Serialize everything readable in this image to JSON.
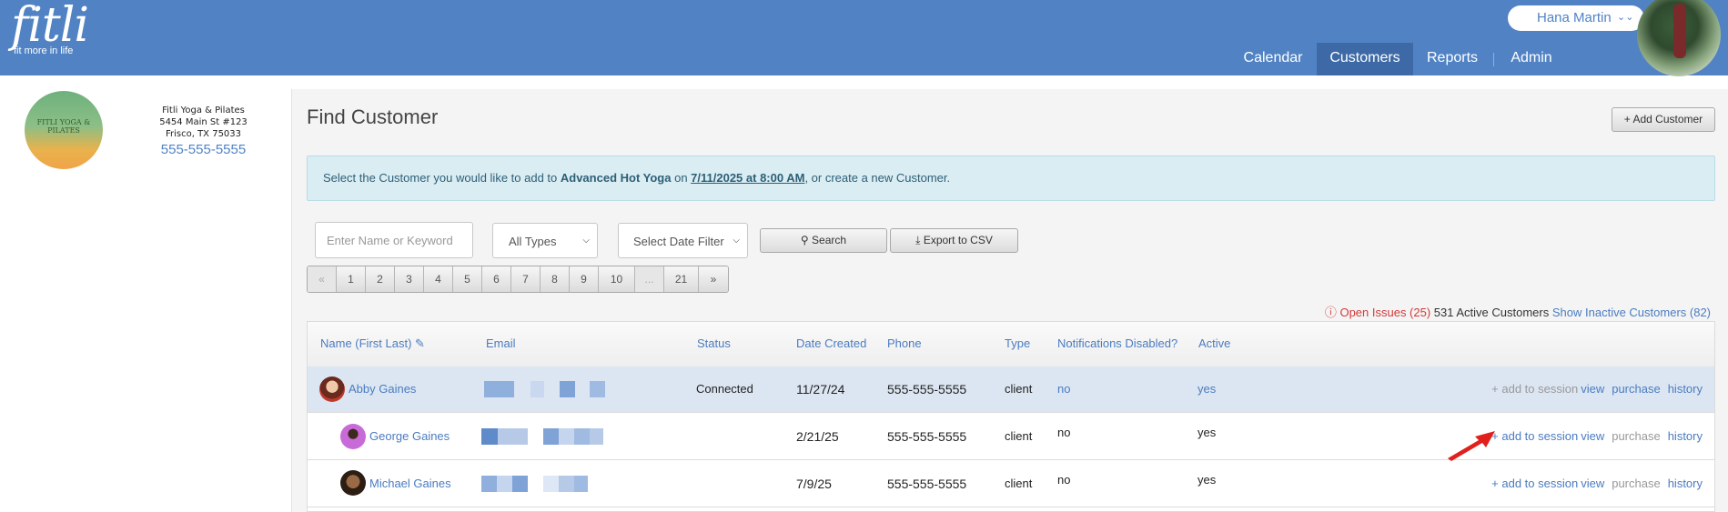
{
  "app": {
    "logo_text": "fitli",
    "logo_tagline": "fit more in life",
    "user_name": "Hana Martin",
    "nav": [
      {
        "label": "Calendar",
        "active": false
      },
      {
        "label": "Customers",
        "active": true
      },
      {
        "label": "Reports",
        "active": false
      },
      {
        "label": "Admin",
        "active": false
      }
    ]
  },
  "studio": {
    "name": "Fitli Yoga & Pilates",
    "address_line1": "5454 Main St #123",
    "address_line2": "Frisco, TX 75033",
    "phone": "555-555-5555",
    "logo_text": "FITLI YOGA & PILATES"
  },
  "page": {
    "title": "Find Customer",
    "add_customer_label": "+ Add Customer",
    "info": {
      "prefix": "Select the Customer you would like to add to ",
      "class_name": "Advanced Hot Yoga",
      "middle": " on ",
      "datetime": "7/11/2025 at 8:00 AM",
      "suffix": ", or create a new Customer."
    }
  },
  "filters": {
    "search_placeholder": "Enter Name or Keyword",
    "type_select": "All Types",
    "date_select": "Select Date Filter",
    "search_button": "Search",
    "export_button": "Export to CSV"
  },
  "pagination": [
    "«",
    "1",
    "2",
    "3",
    "4",
    "5",
    "6",
    "7",
    "8",
    "9",
    "10",
    "...",
    "21",
    "»"
  ],
  "stats": {
    "open_issues": "Open Issues (25)",
    "active_count": "531 Active Customers",
    "inactive_link": "Show Inactive Customers (82)"
  },
  "table": {
    "columns": [
      "Name (First Last)",
      "Email",
      "Status",
      "Date Created",
      "Phone",
      "Type",
      "Notifications Disabled?",
      "Active"
    ],
    "rows": [
      {
        "name": "Abby Gaines",
        "status": "Connected",
        "date_created": "11/27/24",
        "phone": "555-555-5555",
        "type": "client",
        "notifications_disabled": "no",
        "active": "yes",
        "actions": {
          "add": "+ add to session",
          "view": "view",
          "purchase": "purchase",
          "history": "history"
        }
      },
      {
        "name": "George Gaines",
        "status": "",
        "date_created": "2/21/25",
        "phone": "555-555-5555",
        "type": "client",
        "notifications_disabled": "no",
        "active": "yes",
        "actions": {
          "add": "+ add to session",
          "view": "view",
          "purchase": "purchase",
          "history": "history"
        }
      },
      {
        "name": "Michael Gaines",
        "status": "",
        "date_created": "7/9/25",
        "phone": "555-555-5555",
        "type": "client",
        "notifications_disabled": "no",
        "active": "yes",
        "actions": {
          "add": "+ add to session",
          "view": "view",
          "purchase": "purchase",
          "history": "history"
        }
      }
    ]
  },
  "colors": {
    "header": "#5183c4",
    "nav_active": "#3d6aa6",
    "link": "#4b7cc0",
    "info_bg": "#daedf3",
    "issues": "#d23a3a",
    "arrow": "#e0201c"
  }
}
